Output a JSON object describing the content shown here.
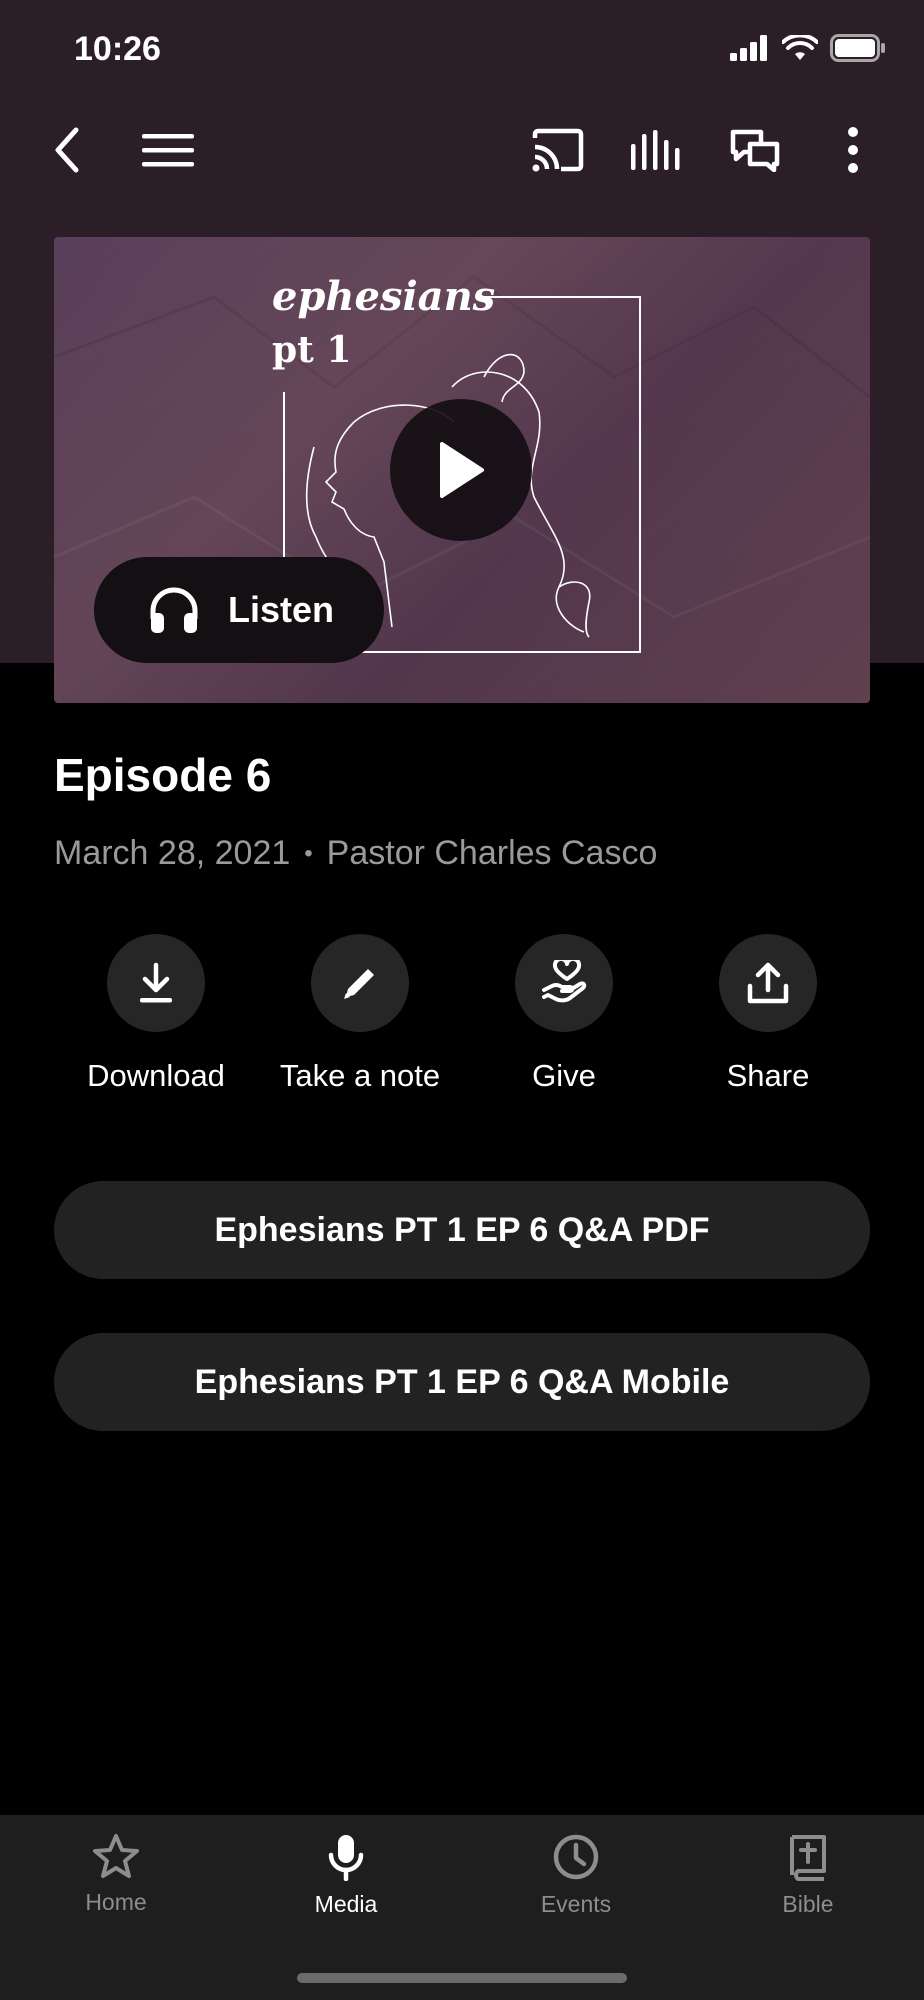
{
  "status_bar": {
    "time": "10:26"
  },
  "hero": {
    "series_title": "ephesians",
    "series_sub": "pt 1",
    "listen_label": "Listen"
  },
  "episode": {
    "title": "Episode 6",
    "date": "March 28, 2021",
    "separator": "•",
    "speaker": "Pastor Charles Casco"
  },
  "actions": [
    {
      "label": "Download",
      "icon": "download-icon"
    },
    {
      "label": "Take a note",
      "icon": "pencil-icon"
    },
    {
      "label": "Give",
      "icon": "give-hand-heart-icon"
    },
    {
      "label": "Share",
      "icon": "share-icon"
    }
  ],
  "links": [
    {
      "label": "Ephesians PT 1 EP 6 Q&A PDF"
    },
    {
      "label": "Ephesians PT 1 EP 6 Q&A Mobile"
    }
  ],
  "tab_bar": {
    "items": [
      {
        "label": "Home",
        "icon": "star-icon",
        "active": false
      },
      {
        "label": "Media",
        "icon": "microphone-icon",
        "active": true
      },
      {
        "label": "Events",
        "icon": "clock-icon",
        "active": false
      },
      {
        "label": "Bible",
        "icon": "bible-icon",
        "active": false
      }
    ]
  },
  "colors": {
    "header_bg": "#2b1e27",
    "background": "#000000",
    "button_bg": "#222222",
    "secondary_text": "#9a9a9a",
    "tab_inactive": "#8d8d8d"
  }
}
